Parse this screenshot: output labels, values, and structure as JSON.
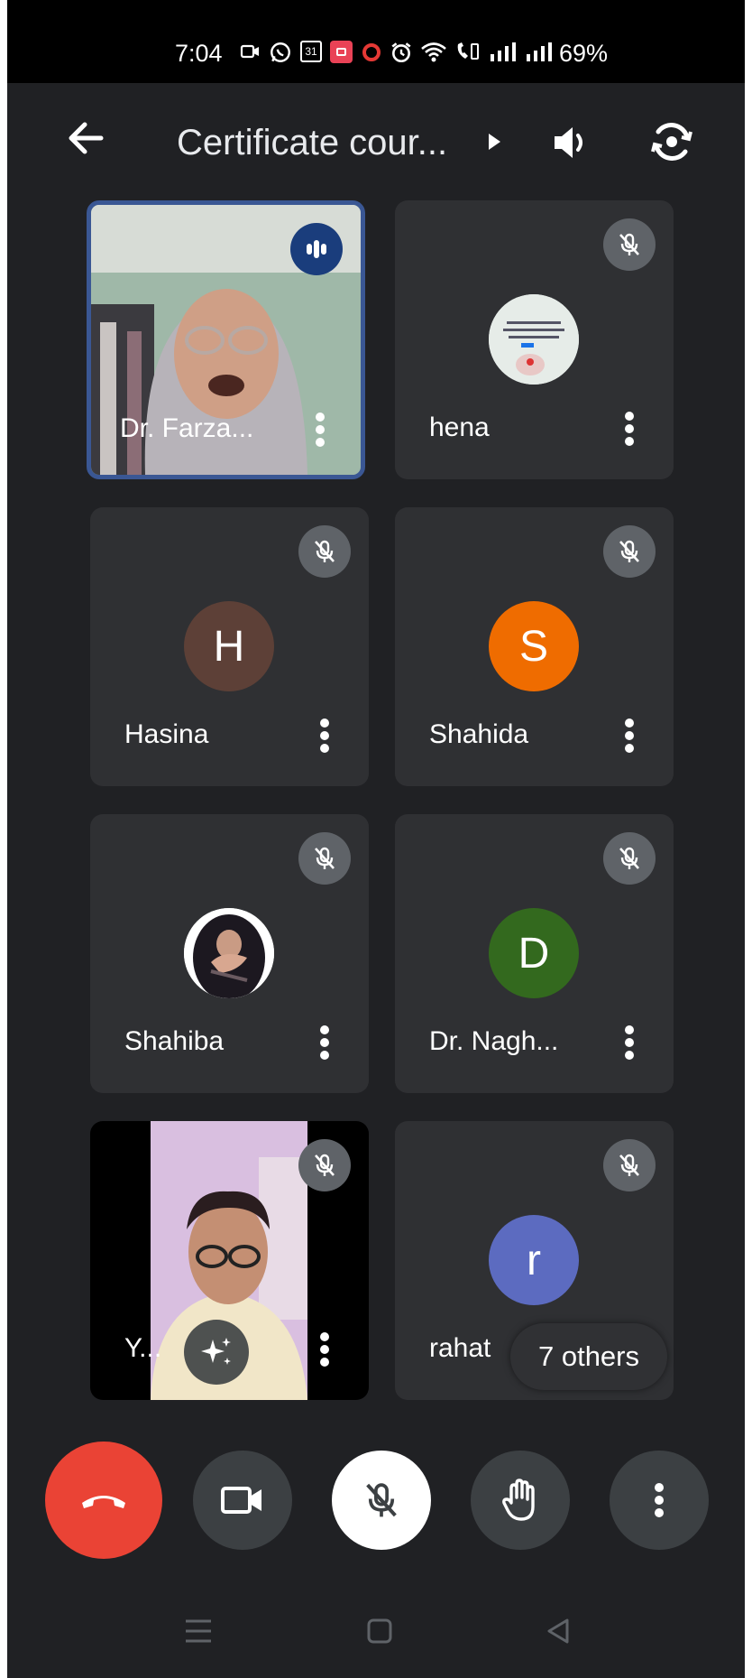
{
  "status_bar": {
    "time": "7:04",
    "battery": "69%",
    "icons": [
      "video-recording-icon",
      "whatsapp-icon",
      "calendar-31-icon",
      "screen-record-icon",
      "circle-icon",
      "alarm-icon",
      "wifi-icon",
      "volte-call-icon",
      "signal-icon",
      "signal-icon-2"
    ],
    "calendar_day": "31"
  },
  "app_bar": {
    "title": "Certificate cour...",
    "icons": [
      "back-arrow-icon",
      "title-expand-icon",
      "speaker-icon",
      "switch-camera-icon"
    ]
  },
  "participants": [
    {
      "name": "Dr. Farza...",
      "kind": "video",
      "speaking": true
    },
    {
      "name": "hena",
      "kind": "photo-avatar",
      "muted": true
    },
    {
      "name": "Hasina",
      "kind": "letter",
      "initial": "H",
      "color": "#5d4037",
      "muted": true
    },
    {
      "name": "Shahida",
      "kind": "letter",
      "initial": "S",
      "color": "#ef6c00",
      "muted": true
    },
    {
      "name": "Shahiba",
      "kind": "photo-avatar",
      "muted": true
    },
    {
      "name": "Dr. Nagh...",
      "kind": "letter",
      "initial": "D",
      "color": "#33691e",
      "muted": true
    },
    {
      "name": "Y...",
      "kind": "video",
      "muted": true
    },
    {
      "name": "rahat",
      "kind": "letter",
      "initial": "r",
      "color": "#5c6bc0",
      "muted": true
    }
  ],
  "others_chip": "7 others",
  "controls": [
    "end-call-button",
    "camera-toggle-button",
    "mic-toggle-button",
    "raise-hand-button",
    "more-options-button"
  ],
  "colors": {
    "background": "#202124",
    "tile": "#2f3033",
    "end_call": "#ea4335",
    "active_border": "#3a5794"
  }
}
